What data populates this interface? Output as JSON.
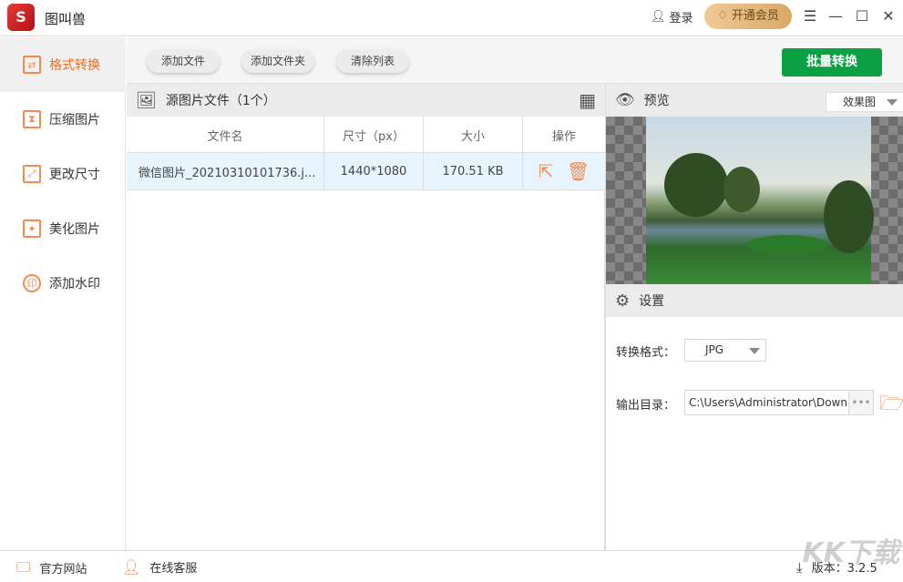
{
  "app": {
    "title": "图叫兽",
    "logo_text": "S"
  },
  "titlebar": {
    "login": "登录",
    "vip": "开通会员"
  },
  "sidebar": {
    "items": [
      {
        "label": "格式转换",
        "icon": "⇄"
      },
      {
        "label": "压缩图片",
        "icon": "⧗"
      },
      {
        "label": "更改尺寸",
        "icon": "⤢"
      },
      {
        "label": "美化图片",
        "icon": "✦"
      },
      {
        "label": "添加水印",
        "icon": "印"
      }
    ]
  },
  "toolbar": {
    "add_file": "添加文件",
    "add_folder": "添加文件夹",
    "clear_list": "清除列表",
    "batch_convert": "批量转换"
  },
  "source": {
    "title": "源图片文件（1个）",
    "columns": [
      "文件名",
      "尺寸（px）",
      "大小",
      "操作"
    ],
    "rows": [
      {
        "name": "微信图片_20210310101736.j...",
        "dims": "1440*1080",
        "size": "170.51 KB"
      }
    ]
  },
  "preview": {
    "title": "预览",
    "view_option": "效果图"
  },
  "settings": {
    "title": "设置",
    "format_label": "转换格式：",
    "format_value": "JPG",
    "output_label": "输出目录：",
    "output_value": "C:\\Users\\Administrator\\Downloads",
    "browse": "•••"
  },
  "footer": {
    "website": "官方网站",
    "support": "在线客服",
    "version": "版本：3.2.5"
  },
  "watermark": "KK下载 www.kkx.net",
  "colors": {
    "accent": "#f36b21",
    "primary": "#0aa043",
    "vip": "#e2b67c"
  }
}
